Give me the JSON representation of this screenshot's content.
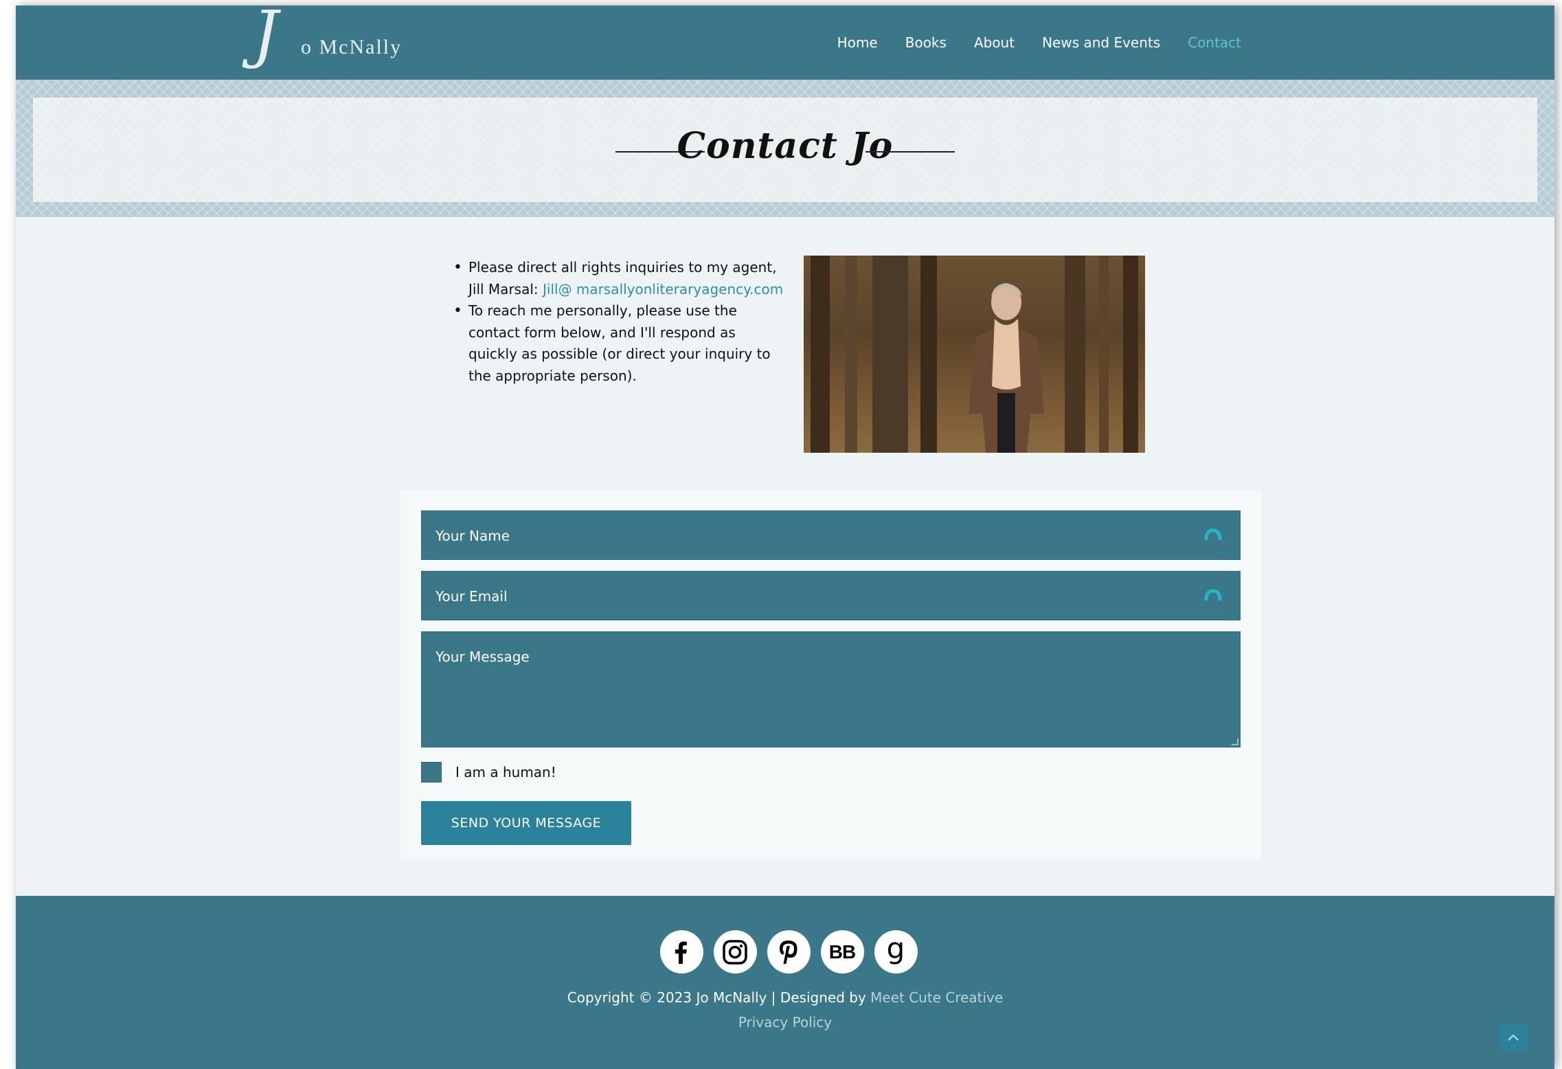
{
  "header": {
    "logo_initial": "J",
    "logo_text": "o McNally",
    "nav": [
      {
        "label": "Home"
      },
      {
        "label": "Books"
      },
      {
        "label": "About"
      },
      {
        "label": "News and Events"
      },
      {
        "label": "Contact",
        "active": true
      }
    ]
  },
  "banner": {
    "title": "Contact Jo"
  },
  "info": {
    "item1_text": "Please direct all rights inquiries to my agent, Jill Marsal: ",
    "item1_link": "Jill@ marsallyonliteraryagency.com",
    "item2_text": "To reach me personally, please use the contact form below, and I'll respond as quickly as possible (or direct your inquiry to the appropriate person)."
  },
  "form": {
    "name_placeholder": "Your Name",
    "email_placeholder": "Your Email",
    "message_placeholder": "Your Message",
    "human_label": "I am a human!",
    "send_label": "SEND YOUR MESSAGE"
  },
  "footer": {
    "social_icons": [
      "facebook-icon",
      "instagram-icon",
      "pinterest-icon",
      "bookbub-icon",
      "goodreads-icon"
    ],
    "bookbub_label": "BB",
    "goodreads_label": "g",
    "copyright_text": "Copyright © 2023 Jo McNally | Designed by ",
    "credit_link": "Meet Cute Creative",
    "privacy_link": "Privacy Policy"
  },
  "colors": {
    "header_bg": "#3a7889",
    "accent": "#5ec5d6",
    "button": "#2b829a",
    "link": "#2b8fa5"
  }
}
